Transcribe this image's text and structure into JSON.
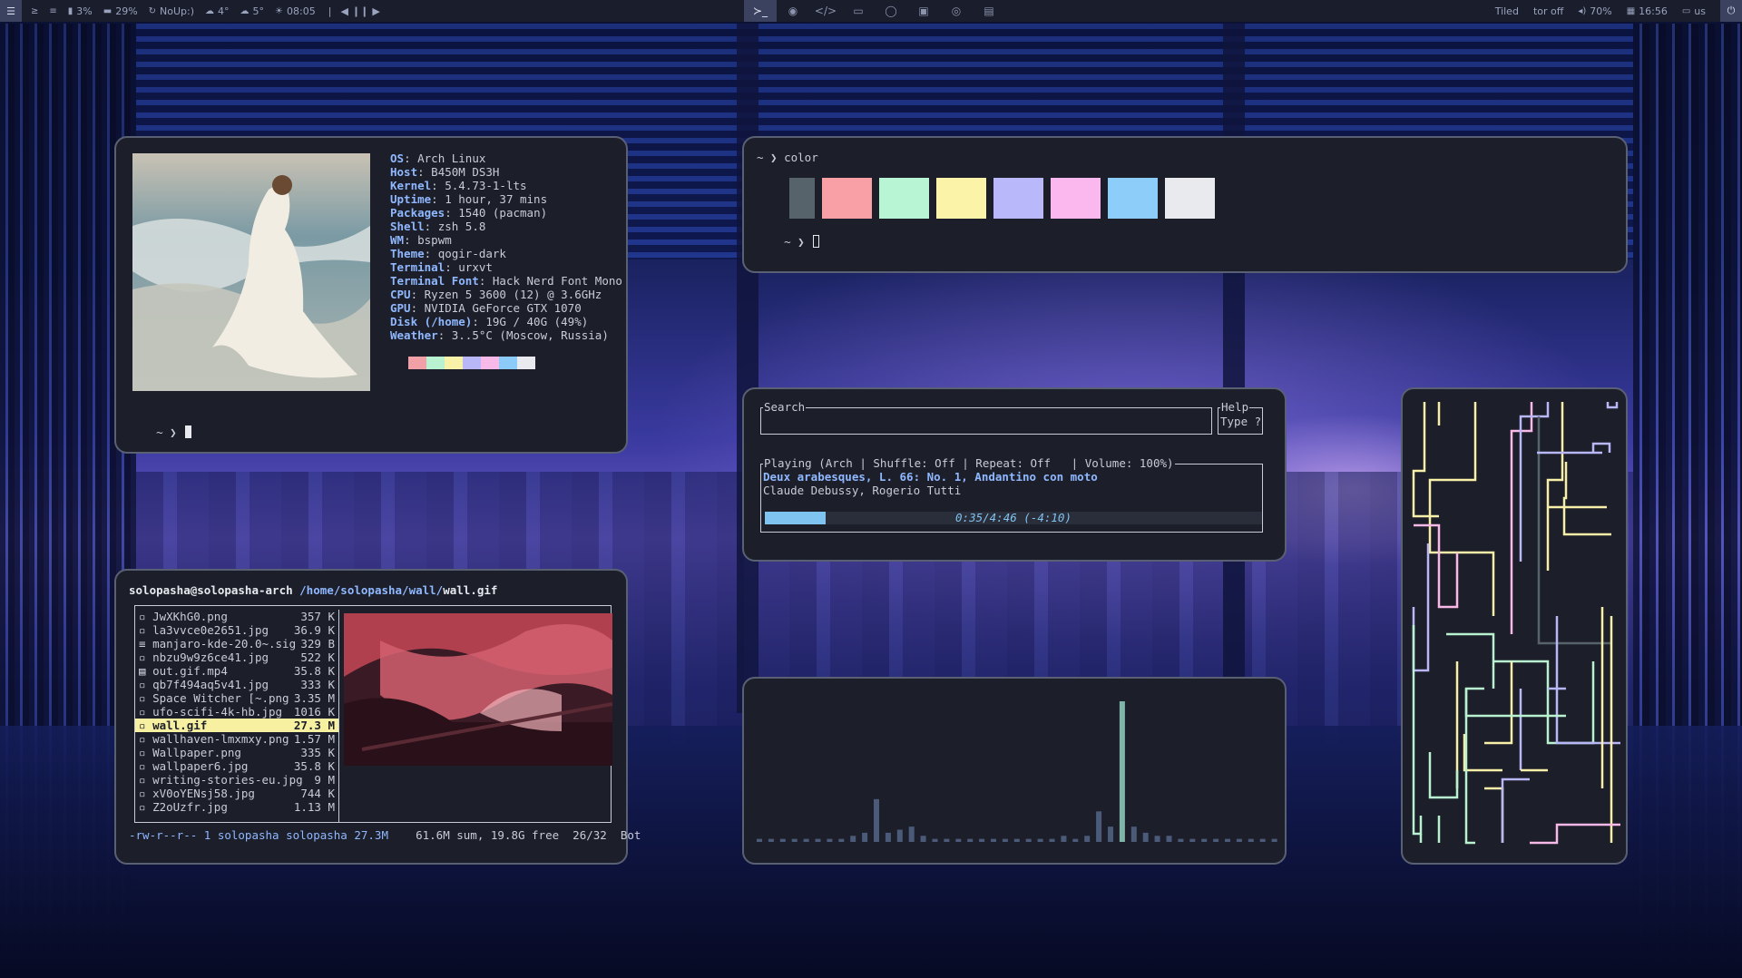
{
  "topbar": {
    "left": [
      {
        "icon": "terminal-icon",
        "glyph": "≥",
        "label": ""
      },
      {
        "icon": "rss-icon",
        "glyph": "≡",
        "label": ""
      },
      {
        "icon": "battery-icon",
        "glyph": "▮",
        "label": "3%"
      },
      {
        "icon": "memory-icon",
        "glyph": "▬",
        "label": "29%"
      },
      {
        "icon": "updates-icon",
        "glyph": "↻",
        "label": "NoUp:)"
      },
      {
        "icon": "cloud-icon",
        "glyph": "☁",
        "label": "4°"
      },
      {
        "icon": "cloud-icon",
        "glyph": "☁",
        "label": "5°"
      },
      {
        "icon": "sun-icon",
        "glyph": "☀",
        "label": "08:05"
      }
    ],
    "separator": "|",
    "media_controls": [
      "◀",
      "❙❙",
      "▶"
    ],
    "workspaces": [
      {
        "name": "terminal",
        "glyph": "≻_",
        "active": true
      },
      {
        "name": "browser",
        "glyph": "◉",
        "active": false
      },
      {
        "name": "code",
        "glyph": "</>",
        "active": false
      },
      {
        "name": "files",
        "glyph": "▭",
        "active": false
      },
      {
        "name": "chat",
        "glyph": "◯",
        "active": false
      },
      {
        "name": "image",
        "glyph": "▣",
        "active": false
      },
      {
        "name": "eye",
        "glyph": "◎",
        "active": false
      },
      {
        "name": "media",
        "glyph": "▤",
        "active": false
      }
    ],
    "right": [
      {
        "icon": "",
        "label": "Tiled"
      },
      {
        "icon": "",
        "label": "tor off"
      },
      {
        "icon": "volume-icon",
        "glyph": "◂)",
        "label": "70%"
      },
      {
        "icon": "calendar-icon",
        "glyph": "▦",
        "label": "16:56"
      },
      {
        "icon": "keyboard-icon",
        "glyph": "▭",
        "label": "us"
      }
    ],
    "power_glyph": "⏻"
  },
  "neofetch": {
    "info": [
      {
        "key": "OS",
        "value": "Arch Linux"
      },
      {
        "key": "Host",
        "value": "B450M DS3H"
      },
      {
        "key": "Kernel",
        "value": "5.4.73-1-lts"
      },
      {
        "key": "Uptime",
        "value": "1 hour, 37 mins"
      },
      {
        "key": "Packages",
        "value": "1540 (pacman)"
      },
      {
        "key": "Shell",
        "value": "zsh 5.8"
      },
      {
        "key": "WM",
        "value": "bspwm"
      },
      {
        "key": "Theme",
        "value": "qogir-dark"
      },
      {
        "key": "Terminal",
        "value": "urxvt"
      },
      {
        "key": "Terminal Font",
        "value": "Hack Nerd Font Mono"
      },
      {
        "key": "CPU",
        "value": "Ryzen 5 3600 (12) @ 3.6GHz"
      },
      {
        "key": "GPU",
        "value": "NVIDIA GeForce GTX 1070"
      },
      {
        "key": "Disk (/home)",
        "value": "19G / 40G (49%)"
      },
      {
        "key": "Weather",
        "value": "3..5°C (Moscow, Russia)"
      }
    ],
    "palette": [
      "#1c1e29",
      "#f2a0a8",
      "#b8f2d0",
      "#f8f2a8",
      "#b8b8f8",
      "#f8b8e8",
      "#8ccaf8",
      "#e8eaf0"
    ],
    "prompt": "~ ❯ "
  },
  "color_term": {
    "line1": "~ ❯ color",
    "line2": "~ ❯ ",
    "swatches": [
      "#1c1e29",
      "#56636b",
      "#f9a0a6",
      "#b8f5d4",
      "#fbf4a8",
      "#b8b8fa",
      "#fbb8ee",
      "#8ccef9",
      "#e8eaee"
    ]
  },
  "ranger": {
    "user": "solopasha@solopasha-arch",
    "path": "/home/solopasha/wall/",
    "file": "wall.gif",
    "files": [
      {
        "icon": "image-file-icon",
        "glyph": "▫",
        "name": "JwXKhG0.png",
        "size": "357 K",
        "selected": false
      },
      {
        "icon": "image-file-icon",
        "glyph": "▫",
        "name": "la3vvce0e2651.jpg",
        "size": "36.9 K",
        "selected": false
      },
      {
        "icon": "text-file-icon",
        "glyph": "≡",
        "name": "manjaro-kde-20.0~.sig",
        "size": "329 B",
        "selected": false
      },
      {
        "icon": "image-file-icon",
        "glyph": "▫",
        "name": "nbzu9w9z6ce41.jpg",
        "size": "522 K",
        "selected": false
      },
      {
        "icon": "video-file-icon",
        "glyph": "▤",
        "name": "out.gif.mp4",
        "size": "35.8 K",
        "selected": false
      },
      {
        "icon": "image-file-icon",
        "glyph": "▫",
        "name": "qb7f494aq5v41.jpg",
        "size": "333 K",
        "selected": false
      },
      {
        "icon": "image-file-icon",
        "glyph": "▫",
        "name": "Space Witcher [~.png",
        "size": "3.35 M",
        "selected": false
      },
      {
        "icon": "image-file-icon",
        "glyph": "▫",
        "name": "ufo-scifi-4k-hb.jpg",
        "size": "1016 K",
        "selected": false
      },
      {
        "icon": "image-file-icon",
        "glyph": "▫",
        "name": "wall.gif",
        "size": "27.3 M",
        "selected": true
      },
      {
        "icon": "image-file-icon",
        "glyph": "▫",
        "name": "wallhaven-lmxmxy.png",
        "size": "1.57 M",
        "selected": false
      },
      {
        "icon": "image-file-icon",
        "glyph": "▫",
        "name": "Wallpaper.png",
        "size": "335 K",
        "selected": false
      },
      {
        "icon": "image-file-icon",
        "glyph": "▫",
        "name": "wallpaper6.jpg",
        "size": "35.8 K",
        "selected": false
      },
      {
        "icon": "image-file-icon",
        "glyph": "▫",
        "name": "writing-stories-eu.jpg",
        "size": "9 M",
        "selected": false
      },
      {
        "icon": "image-file-icon",
        "glyph": "▫",
        "name": "xV0oYENsj58.jpg",
        "size": "744 K",
        "selected": false
      },
      {
        "icon": "image-file-icon",
        "glyph": "▫",
        "name": "Z2oUzfr.jpg",
        "size": "1.13 M",
        "selected": false
      }
    ],
    "status_left": "-rw-r--r-- 1 solopasha solopasha 27.3M",
    "status_right": "61.6M sum, 19.8G free  26/32  Bot"
  },
  "music": {
    "search_label": "Search",
    "help_label": "Help",
    "help_text": "Type ?",
    "status_line": "Playing (Arch | Shuffle: Off | Repeat: Off   | Volume: 100%)",
    "track": "Deux arabesques, L. 66: No. 1, Andantino con moto",
    "artist": "Claude Debussy, Rogerio Tutti",
    "time": "0:35/4:46 (-4:10)",
    "progress": 0.122
  },
  "visualizer": {
    "bars": [
      1,
      1,
      1,
      1,
      1,
      1,
      1,
      1,
      2,
      3,
      14,
      3,
      4,
      5,
      2,
      1,
      1,
      1,
      1,
      1,
      1,
      1,
      1,
      1,
      1,
      1,
      2,
      1,
      2,
      10,
      5,
      46,
      5,
      3,
      2,
      2,
      1,
      1,
      1,
      1,
      1,
      1,
      1,
      1,
      1
    ]
  }
}
